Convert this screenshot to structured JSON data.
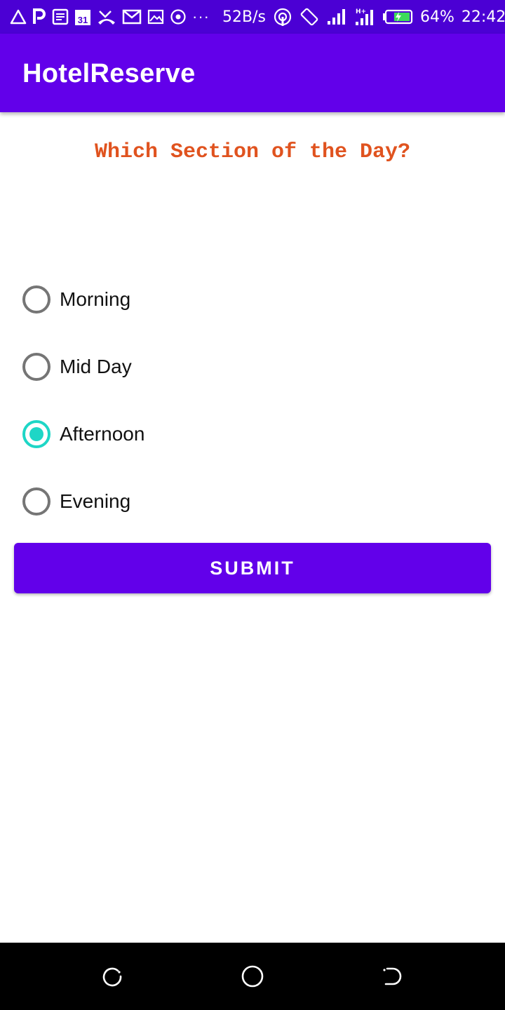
{
  "status_bar": {
    "left_icons": [
      "warning-triangle-icon",
      "parking-icon",
      "notes-icon",
      "calendar-icon",
      "missed-call-icon",
      "gmail-icon",
      "gallery-icon",
      "radio-icon"
    ],
    "overflow": "···",
    "net_speed": "52B/s",
    "right_icons": [
      "hotspot-icon",
      "rotation-icon",
      "signal-icon",
      "signal-hplus-icon",
      "battery-charging-icon"
    ],
    "calendar_day": "31",
    "network_type": "H+",
    "battery_percent": "64%",
    "time": "22:42"
  },
  "app_bar": {
    "title": "HotelReserve"
  },
  "question": "Which Section of the Day?",
  "options": [
    {
      "label": "Morning",
      "checked": false
    },
    {
      "label": "Mid Day",
      "checked": false
    },
    {
      "label": "Afternoon",
      "checked": true
    },
    {
      "label": "Evening",
      "checked": false
    }
  ],
  "submit_label": "SUBMIT",
  "nav_bar": {
    "buttons": [
      "recents-icon",
      "home-icon",
      "back-icon"
    ]
  },
  "colors": {
    "status_bar": "#4b00d4",
    "primary": "#6200ea",
    "accent": "#1ed6c6",
    "question_text": "#e0531f"
  }
}
